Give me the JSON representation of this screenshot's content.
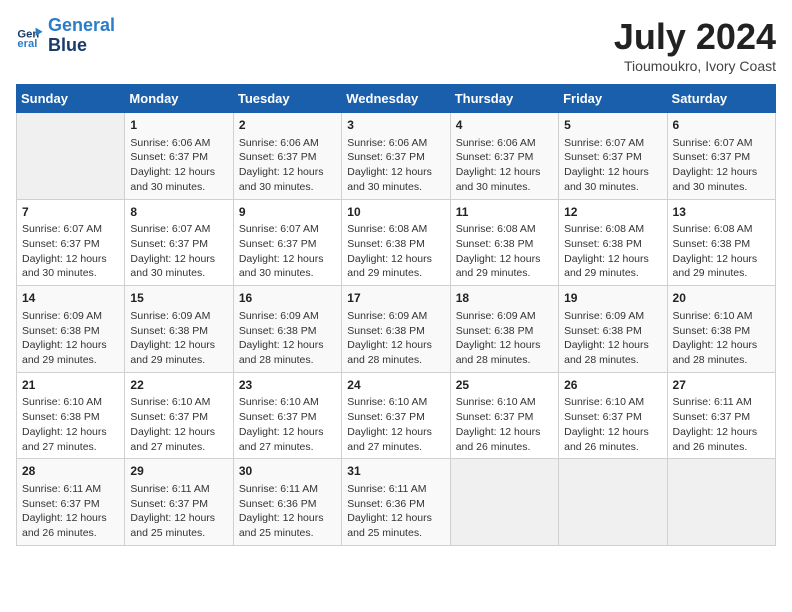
{
  "logo": {
    "line1": "General",
    "line2": "Blue"
  },
  "title": "July 2024",
  "location": "Tioumoukro, Ivory Coast",
  "days_header": [
    "Sunday",
    "Monday",
    "Tuesday",
    "Wednesday",
    "Thursday",
    "Friday",
    "Saturday"
  ],
  "weeks": [
    [
      {
        "day": "",
        "info": ""
      },
      {
        "day": "1",
        "info": "Sunrise: 6:06 AM\nSunset: 6:37 PM\nDaylight: 12 hours\nand 30 minutes."
      },
      {
        "day": "2",
        "info": "Sunrise: 6:06 AM\nSunset: 6:37 PM\nDaylight: 12 hours\nand 30 minutes."
      },
      {
        "day": "3",
        "info": "Sunrise: 6:06 AM\nSunset: 6:37 PM\nDaylight: 12 hours\nand 30 minutes."
      },
      {
        "day": "4",
        "info": "Sunrise: 6:06 AM\nSunset: 6:37 PM\nDaylight: 12 hours\nand 30 minutes."
      },
      {
        "day": "5",
        "info": "Sunrise: 6:07 AM\nSunset: 6:37 PM\nDaylight: 12 hours\nand 30 minutes."
      },
      {
        "day": "6",
        "info": "Sunrise: 6:07 AM\nSunset: 6:37 PM\nDaylight: 12 hours\nand 30 minutes."
      }
    ],
    [
      {
        "day": "7",
        "info": "Sunrise: 6:07 AM\nSunset: 6:37 PM\nDaylight: 12 hours\nand 30 minutes."
      },
      {
        "day": "8",
        "info": "Sunrise: 6:07 AM\nSunset: 6:37 PM\nDaylight: 12 hours\nand 30 minutes."
      },
      {
        "day": "9",
        "info": "Sunrise: 6:07 AM\nSunset: 6:37 PM\nDaylight: 12 hours\nand 30 minutes."
      },
      {
        "day": "10",
        "info": "Sunrise: 6:08 AM\nSunset: 6:38 PM\nDaylight: 12 hours\nand 29 minutes."
      },
      {
        "day": "11",
        "info": "Sunrise: 6:08 AM\nSunset: 6:38 PM\nDaylight: 12 hours\nand 29 minutes."
      },
      {
        "day": "12",
        "info": "Sunrise: 6:08 AM\nSunset: 6:38 PM\nDaylight: 12 hours\nand 29 minutes."
      },
      {
        "day": "13",
        "info": "Sunrise: 6:08 AM\nSunset: 6:38 PM\nDaylight: 12 hours\nand 29 minutes."
      }
    ],
    [
      {
        "day": "14",
        "info": "Sunrise: 6:09 AM\nSunset: 6:38 PM\nDaylight: 12 hours\nand 29 minutes."
      },
      {
        "day": "15",
        "info": "Sunrise: 6:09 AM\nSunset: 6:38 PM\nDaylight: 12 hours\nand 29 minutes."
      },
      {
        "day": "16",
        "info": "Sunrise: 6:09 AM\nSunset: 6:38 PM\nDaylight: 12 hours\nand 28 minutes."
      },
      {
        "day": "17",
        "info": "Sunrise: 6:09 AM\nSunset: 6:38 PM\nDaylight: 12 hours\nand 28 minutes."
      },
      {
        "day": "18",
        "info": "Sunrise: 6:09 AM\nSunset: 6:38 PM\nDaylight: 12 hours\nand 28 minutes."
      },
      {
        "day": "19",
        "info": "Sunrise: 6:09 AM\nSunset: 6:38 PM\nDaylight: 12 hours\nand 28 minutes."
      },
      {
        "day": "20",
        "info": "Sunrise: 6:10 AM\nSunset: 6:38 PM\nDaylight: 12 hours\nand 28 minutes."
      }
    ],
    [
      {
        "day": "21",
        "info": "Sunrise: 6:10 AM\nSunset: 6:38 PM\nDaylight: 12 hours\nand 27 minutes."
      },
      {
        "day": "22",
        "info": "Sunrise: 6:10 AM\nSunset: 6:37 PM\nDaylight: 12 hours\nand 27 minutes."
      },
      {
        "day": "23",
        "info": "Sunrise: 6:10 AM\nSunset: 6:37 PM\nDaylight: 12 hours\nand 27 minutes."
      },
      {
        "day": "24",
        "info": "Sunrise: 6:10 AM\nSunset: 6:37 PM\nDaylight: 12 hours\nand 27 minutes."
      },
      {
        "day": "25",
        "info": "Sunrise: 6:10 AM\nSunset: 6:37 PM\nDaylight: 12 hours\nand 26 minutes."
      },
      {
        "day": "26",
        "info": "Sunrise: 6:10 AM\nSunset: 6:37 PM\nDaylight: 12 hours\nand 26 minutes."
      },
      {
        "day": "27",
        "info": "Sunrise: 6:11 AM\nSunset: 6:37 PM\nDaylight: 12 hours\nand 26 minutes."
      }
    ],
    [
      {
        "day": "28",
        "info": "Sunrise: 6:11 AM\nSunset: 6:37 PM\nDaylight: 12 hours\nand 26 minutes."
      },
      {
        "day": "29",
        "info": "Sunrise: 6:11 AM\nSunset: 6:37 PM\nDaylight: 12 hours\nand 25 minutes."
      },
      {
        "day": "30",
        "info": "Sunrise: 6:11 AM\nSunset: 6:36 PM\nDaylight: 12 hours\nand 25 minutes."
      },
      {
        "day": "31",
        "info": "Sunrise: 6:11 AM\nSunset: 6:36 PM\nDaylight: 12 hours\nand 25 minutes."
      },
      {
        "day": "",
        "info": ""
      },
      {
        "day": "",
        "info": ""
      },
      {
        "day": "",
        "info": ""
      }
    ]
  ]
}
